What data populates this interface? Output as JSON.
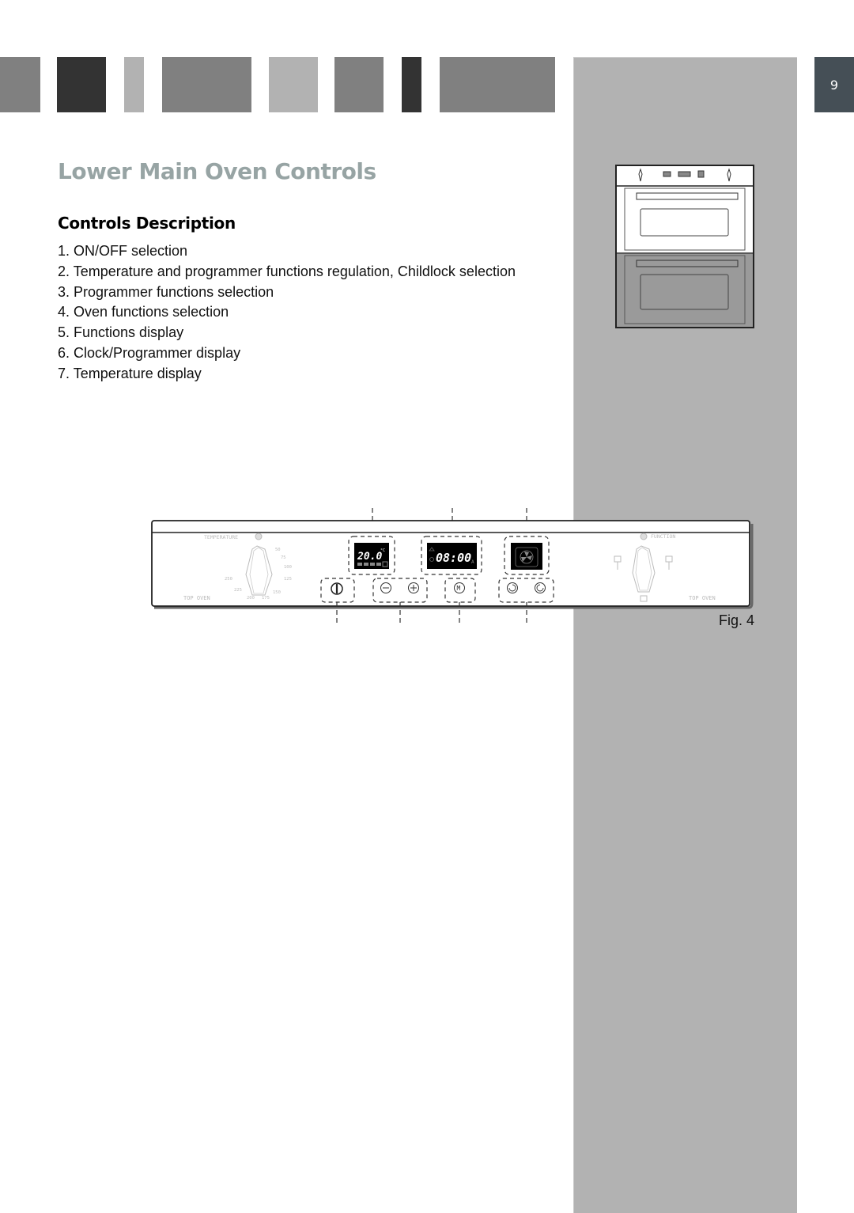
{
  "header": {
    "page_number": "9",
    "blocks": [
      {
        "color": "#808080"
      },
      {
        "color": "#333333"
      },
      {
        "color": "#b2b2b2"
      },
      {
        "color": "#808080"
      },
      {
        "color": "#b2b2b2"
      },
      {
        "color": "#808080"
      },
      {
        "color": "#333333"
      },
      {
        "color": "#808080"
      }
    ],
    "page_tab_color": "#454f56",
    "sidebar_color": "#b2b2b2"
  },
  "section": {
    "title": "Lower Main Oven Controls",
    "title_color": "#97a4a4",
    "subtitle": "Controls Description",
    "items": [
      "1. ON/OFF selection",
      "2. Temperature and programmer functions regulation, Childlock selection",
      "3. Programmer functions selection",
      "4. Oven functions selection",
      "5. Functions display",
      "6. Clock/Programmer display",
      "7. Temperature display"
    ]
  },
  "figure": {
    "caption": "Fig. 4",
    "panel": {
      "temperature_label": "TEMPERATURE",
      "function_label": "FUNCTION",
      "top_oven_left": "TOP OVEN",
      "top_oven_right": "TOP OVEN",
      "temperature_scale": [
        "50",
        "75",
        "100",
        "125",
        "150",
        "175",
        "200",
        "225",
        "250"
      ],
      "temp_display": "20.0",
      "temp_unit": "°C",
      "clock_display": "08:00",
      "clock_suffix": "A",
      "minus_symbol": "−",
      "plus_symbol": "+",
      "mode_symbol": "M"
    }
  }
}
